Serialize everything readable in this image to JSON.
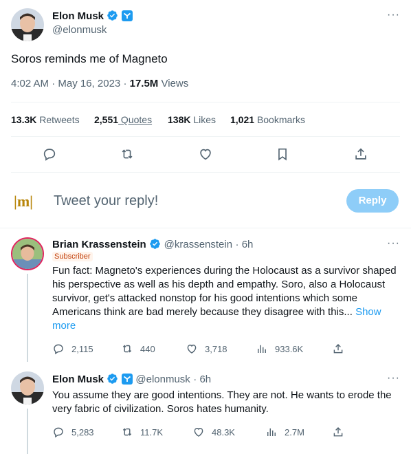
{
  "main_tweet": {
    "author_name": "Elon Musk",
    "author_handle": "@elonmusk",
    "text": "Soros reminds me of Magneto",
    "time": "4:02 AM · May 16, 2023",
    "views_count": "17.5M",
    "views_label": "Views",
    "stats": {
      "retweets_count": "13.3K",
      "retweets_label": "Retweets",
      "quotes_count": "2,551",
      "quotes_label": " Quotes",
      "likes_count": "138K",
      "likes_label": "Likes",
      "bookmarks_count": "1,021",
      "bookmarks_label": "Bookmarks"
    },
    "actions": [
      "reply-icon",
      "retweet-icon",
      "like-icon",
      "bookmark-icon",
      "share-icon"
    ]
  },
  "composer": {
    "avatar_text": "|m|",
    "placeholder": "Tweet your reply!",
    "reply_button": "Reply"
  },
  "replies": [
    {
      "author_name": "Brian Krassenstein",
      "author_handle": "@krassenstein",
      "time": "6h",
      "badge": "Subscriber",
      "text": "Fun fact:  Magneto's experiences during the Holocaust as a survivor shaped his perspective as well as his depth and empathy.  Soro, also a Holocaust survivor, get's attacked nonstop for his good intentions which some Americans think are bad merely because they disagree with this...",
      "show_more": "Show more",
      "replies": "2,115",
      "retweets": "440",
      "likes": "3,718",
      "views": "933.6K"
    },
    {
      "author_name": "Elon Musk",
      "author_handle": "@elonmusk",
      "time": "6h",
      "text": "You assume they are good intentions. They are not. He wants to erode the very fabric of civilization. Soros hates humanity.",
      "replies": "5,283",
      "retweets": "11.7K",
      "likes": "48.3K",
      "views": "2.7M"
    }
  ],
  "colors": {
    "accent": "#1d9bf0",
    "reply_button_disabled": "#8ecdf8",
    "secondary_text": "#536471",
    "gold_badge": "#f4c34a"
  }
}
